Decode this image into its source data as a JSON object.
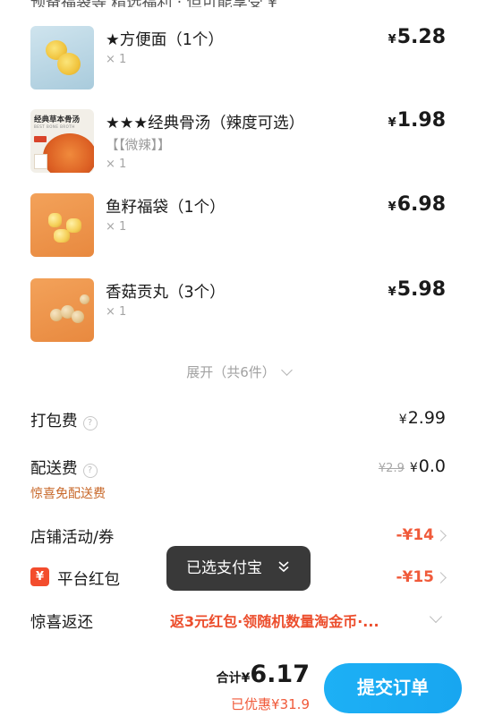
{
  "top_cutoff": "预备福袋等   精选福利 · 但可能享受   ¥",
  "items": [
    {
      "name": "★方便面（1个）",
      "option": "",
      "qty": "× 1",
      "price_symbol": "¥",
      "price": "5.28",
      "thumb_icon": "instant-noodle-icon"
    },
    {
      "name": "★★★经典骨汤（辣度可选）",
      "option": "【【微辣】】",
      "qty": "× 1",
      "price_symbol": "¥",
      "price": "1.98",
      "thumb_icon": "bone-soup-icon",
      "thumb_header": "经典草本骨汤",
      "thumb_sub": "BEST BONE BROTH"
    },
    {
      "name": "鱼籽福袋（1个）",
      "option": "",
      "qty": "× 1",
      "price_symbol": "¥",
      "price": "6.98",
      "thumb_icon": "fish-roe-bag-icon"
    },
    {
      "name": "香菇贡丸（3个）",
      "option": "",
      "qty": "× 1",
      "price_symbol": "¥",
      "price": "5.98",
      "thumb_icon": "mushroom-meatball-icon"
    }
  ],
  "expand_label": "展开（共6件）",
  "packing": {
    "label": "打包费",
    "value_symbol": "¥",
    "value": "2.99"
  },
  "delivery": {
    "label": "配送费",
    "original": "¥2.9",
    "value_symbol": "¥",
    "value": "0.0",
    "note": "惊喜免配送费"
  },
  "store_promo": {
    "label": "店铺活动/券",
    "value": "-¥14"
  },
  "platform_redpacket": {
    "badge": "¥",
    "label": "平台红包",
    "value": "-¥15"
  },
  "surprise": {
    "label": "惊喜返还",
    "value": "返3元红包·领随机数量淘金币·..."
  },
  "toast": {
    "text": "已选支付宝"
  },
  "footer": {
    "total_label": "合计",
    "total_symbol": "¥",
    "total": "6.17",
    "saved": "已优惠¥31.9",
    "submit": "提交订单"
  },
  "colors": {
    "accent_blue": "#1DAEF4",
    "discount_red": "#F05A3A",
    "note_orange": "#C8682A"
  }
}
